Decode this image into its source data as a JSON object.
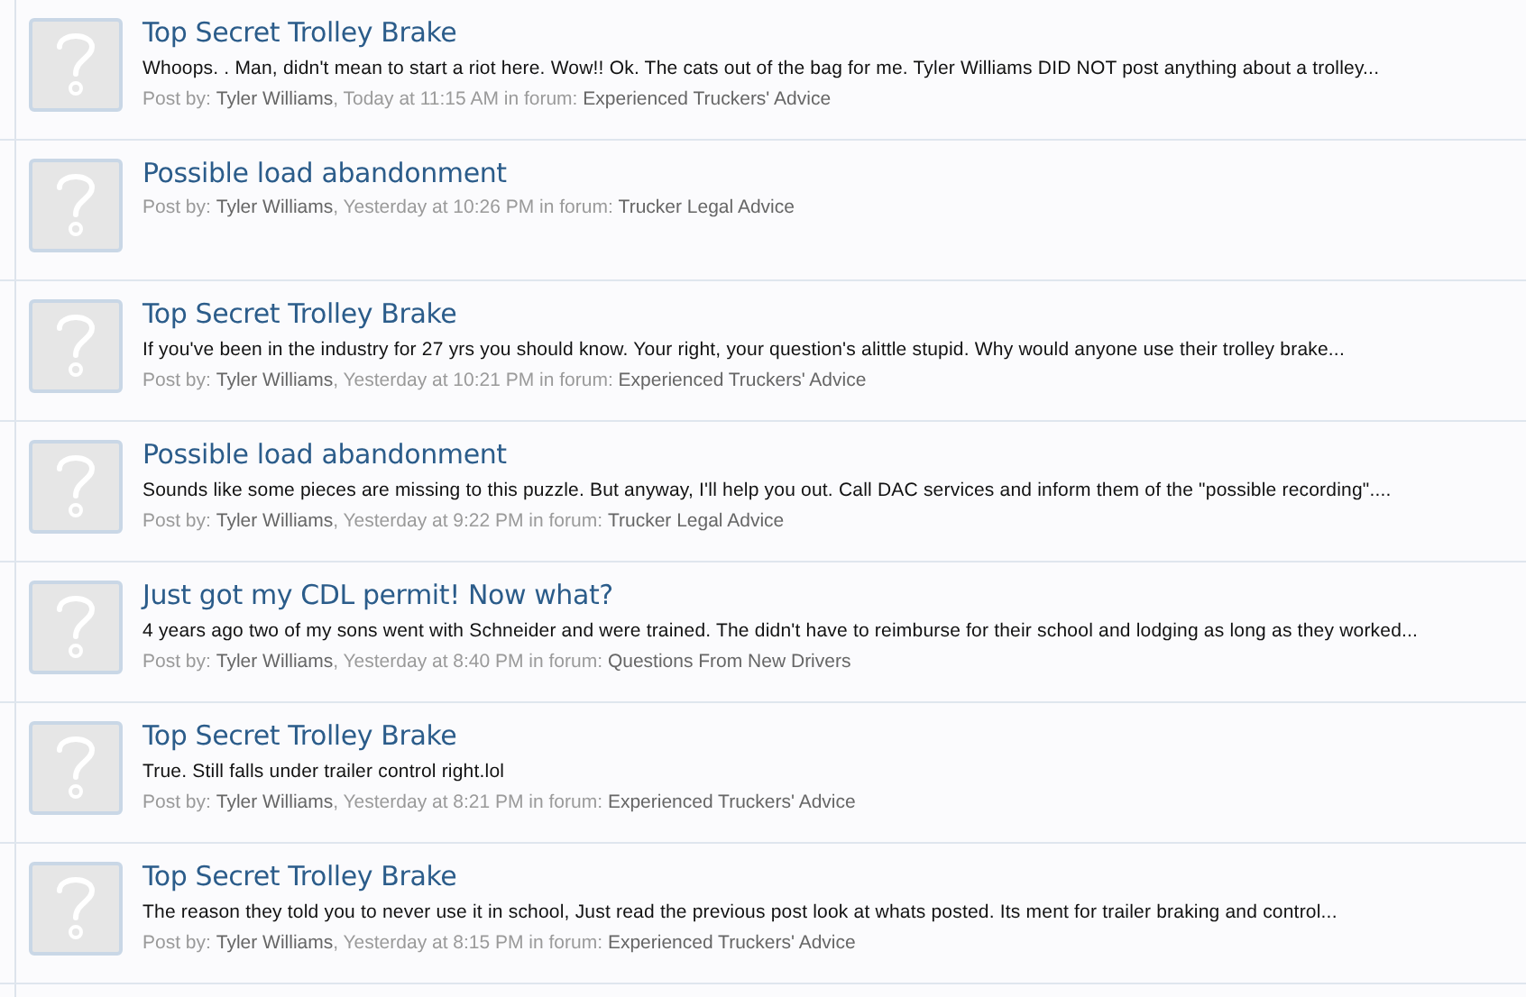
{
  "results": [
    {
      "title": "Top Secret Trolley Brake",
      "snippet": "Whoops. . Man, didn't mean to start a riot here. Wow!! Ok. The cats out of the bag for me. Tyler Williams DID NOT post anything about a trolley...",
      "post_by": "Post by:",
      "author": "Tyler Williams",
      "date": ", Today at 11:15 AM in forum:",
      "forum": "Experienced Truckers' Advice"
    },
    {
      "title": "Possible load abandonment",
      "post_by": "Post by:",
      "author": "Tyler Williams",
      "date": ", Yesterday at 10:26 PM in forum:",
      "forum": "Trucker Legal Advice"
    },
    {
      "title": "Top Secret Trolley Brake",
      "snippet": "If you've been in the industry for 27 yrs you should know. Your right, your question's alittle stupid. Why would anyone use their trolley brake...",
      "post_by": "Post by:",
      "author": "Tyler Williams",
      "date": ", Yesterday at 10:21 PM in forum:",
      "forum": "Experienced Truckers' Advice"
    },
    {
      "title": "Possible load abandonment",
      "snippet": "Sounds like some pieces are missing to this puzzle. But anyway, I'll help you out. Call DAC services and inform them of the \"possible recording\"....",
      "post_by": "Post by:",
      "author": "Tyler Williams",
      "date": ", Yesterday at 9:22 PM in forum:",
      "forum": "Trucker Legal Advice"
    },
    {
      "title": "Just got my CDL permit! Now what?",
      "snippet": "4 years ago two of my sons went with Schneider and were trained. The didn't have to reimburse for their school and lodging as long as they worked...",
      "post_by": "Post by:",
      "author": "Tyler Williams",
      "date": ", Yesterday at 8:40 PM in forum:",
      "forum": "Questions From New Drivers"
    },
    {
      "title": "Top Secret Trolley Brake",
      "snippet": "True. Still falls under trailer control right.lol",
      "post_by": "Post by:",
      "author": "Tyler Williams",
      "date": ", Yesterday at 8:21 PM in forum:",
      "forum": "Experienced Truckers' Advice"
    },
    {
      "title": "Top Secret Trolley Brake",
      "snippet": "The reason they told you to never use it in school, Just read the previous post look at whats posted. Its ment for trailer braking and control...",
      "post_by": "Post by:",
      "author": "Tyler Williams",
      "date": ", Yesterday at 8:15 PM in forum:",
      "forum": "Experienced Truckers' Advice"
    }
  ]
}
